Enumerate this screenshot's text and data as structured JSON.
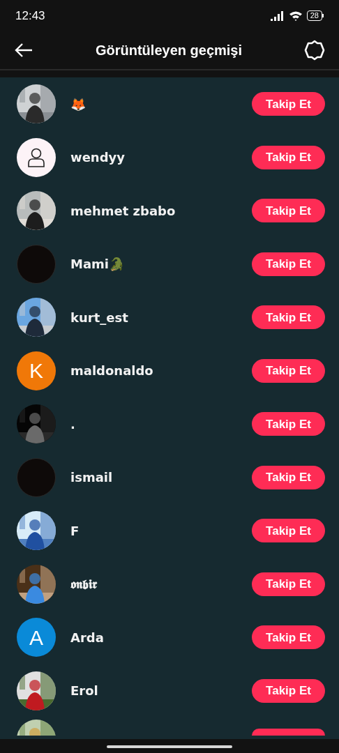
{
  "status_bar": {
    "time": "12:43",
    "battery": "28"
  },
  "header": {
    "title": "Görüntüleyen geçmişi"
  },
  "users": [
    {
      "name": "🦊",
      "avatar": {
        "kind": "picture"
      },
      "button": "Takip Et"
    },
    {
      "name": "wendyy",
      "avatar": {
        "kind": "default"
      },
      "button": "Takip Et"
    },
    {
      "name": "mehmet zbabo",
      "avatar": {
        "kind": "picture"
      },
      "button": "Takip Et"
    },
    {
      "name": "Mami🐊",
      "avatar": {
        "kind": "dark"
      },
      "button": "Takip Et"
    },
    {
      "name": "kurt_est",
      "avatar": {
        "kind": "picture"
      },
      "button": "Takip Et"
    },
    {
      "name": "maldonaldo",
      "avatar": {
        "kind": "letter",
        "letter": "K",
        "color": "#f07808"
      },
      "button": "Takip Et"
    },
    {
      "name": ".",
      "avatar": {
        "kind": "picture"
      },
      "button": "Takip Et"
    },
    {
      "name": "ismail",
      "avatar": {
        "kind": "dark"
      },
      "button": "Takip Et"
    },
    {
      "name": "F",
      "avatar": {
        "kind": "picture"
      },
      "button": "Takip Et"
    },
    {
      "name": "𝖔𝖓𝖇𝖎𝖗",
      "avatar": {
        "kind": "picture"
      },
      "button": "Takip Et"
    },
    {
      "name": "Arda",
      "avatar": {
        "kind": "letter",
        "letter": "A",
        "color": "#0a8ad8"
      },
      "button": "Takip Et"
    },
    {
      "name": "Erol",
      "avatar": {
        "kind": "picture"
      },
      "button": "Takip Et"
    },
    {
      "avatar": {
        "kind": "picture"
      }
    }
  ]
}
